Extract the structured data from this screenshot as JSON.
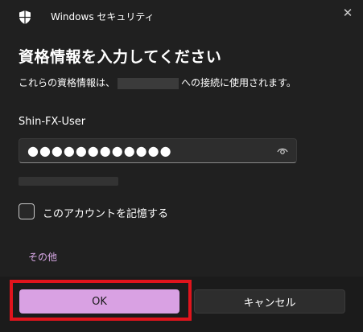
{
  "window": {
    "title": "Windows セキュリティ",
    "close_icon": "close-icon",
    "app_icon": "shield-icon"
  },
  "main": {
    "heading": "資格情報を入力してください",
    "subtitle_prefix": "これらの資格情報は、",
    "subtitle_suffix": "への接続に使用されます。",
    "username": "Shin-FX-User",
    "password_value": "●●●●●●●●●●●●",
    "reveal_icon": "eye-icon",
    "remember_label": "このアカウントを記憶する",
    "remember_checked": false,
    "more_link": "その他"
  },
  "footer": {
    "ok_label": "OK",
    "cancel_label": "キャンセル"
  },
  "colors": {
    "background": "#202020",
    "accent": "#d9a1e3",
    "link": "#d8a9e6",
    "highlight": "#e0141c"
  }
}
